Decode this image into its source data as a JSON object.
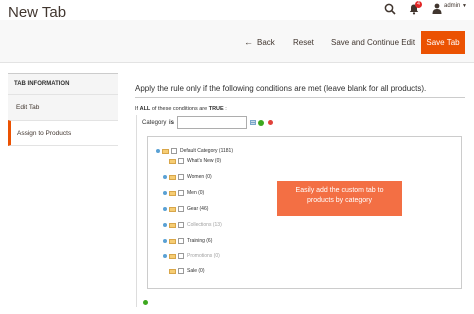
{
  "header": {
    "title": "New Tab",
    "notification_count": "4",
    "user_name": "admin"
  },
  "actions": {
    "back_label": "Back",
    "reset_label": "Reset",
    "save_continue_label": "Save and Continue Edit",
    "save_label": "Save Tab"
  },
  "sidebar": {
    "title": "TAB INFORMATION",
    "items": [
      {
        "label": "Edit Tab",
        "active": false
      },
      {
        "label": "Assign to Products",
        "active": true
      }
    ]
  },
  "rule": {
    "heading": "Apply the rule only if the following conditions are met (leave blank for all products).",
    "if_text": "If",
    "aggregator": "ALL",
    "middle_text": "of these conditions are",
    "value": "TRUE",
    "suffix": ":",
    "condition_label": "Category",
    "operator": "is",
    "input_value": ""
  },
  "tree": [
    {
      "label": "Default Category (1181)",
      "disabled": false,
      "expander": true
    },
    {
      "label": "What's New (0)",
      "disabled": false,
      "expander": false
    },
    {
      "label": "Women (0)",
      "disabled": false,
      "expander": true
    },
    {
      "label": "Men (0)",
      "disabled": false,
      "expander": true
    },
    {
      "label": "Gear (46)",
      "disabled": false,
      "expander": true
    },
    {
      "label": "Collections (13)",
      "disabled": true,
      "expander": true
    },
    {
      "label": "Training (6)",
      "disabled": false,
      "expander": true
    },
    {
      "label": "Promotions (0)",
      "disabled": true,
      "expander": true
    },
    {
      "label": "Sale (0)",
      "disabled": false,
      "expander": false
    }
  ],
  "callout": {
    "line1": "Easily add the custom tab to",
    "line2": "products by category"
  },
  "colors": {
    "accent": "#eb5202",
    "callout": "#f36f44"
  }
}
